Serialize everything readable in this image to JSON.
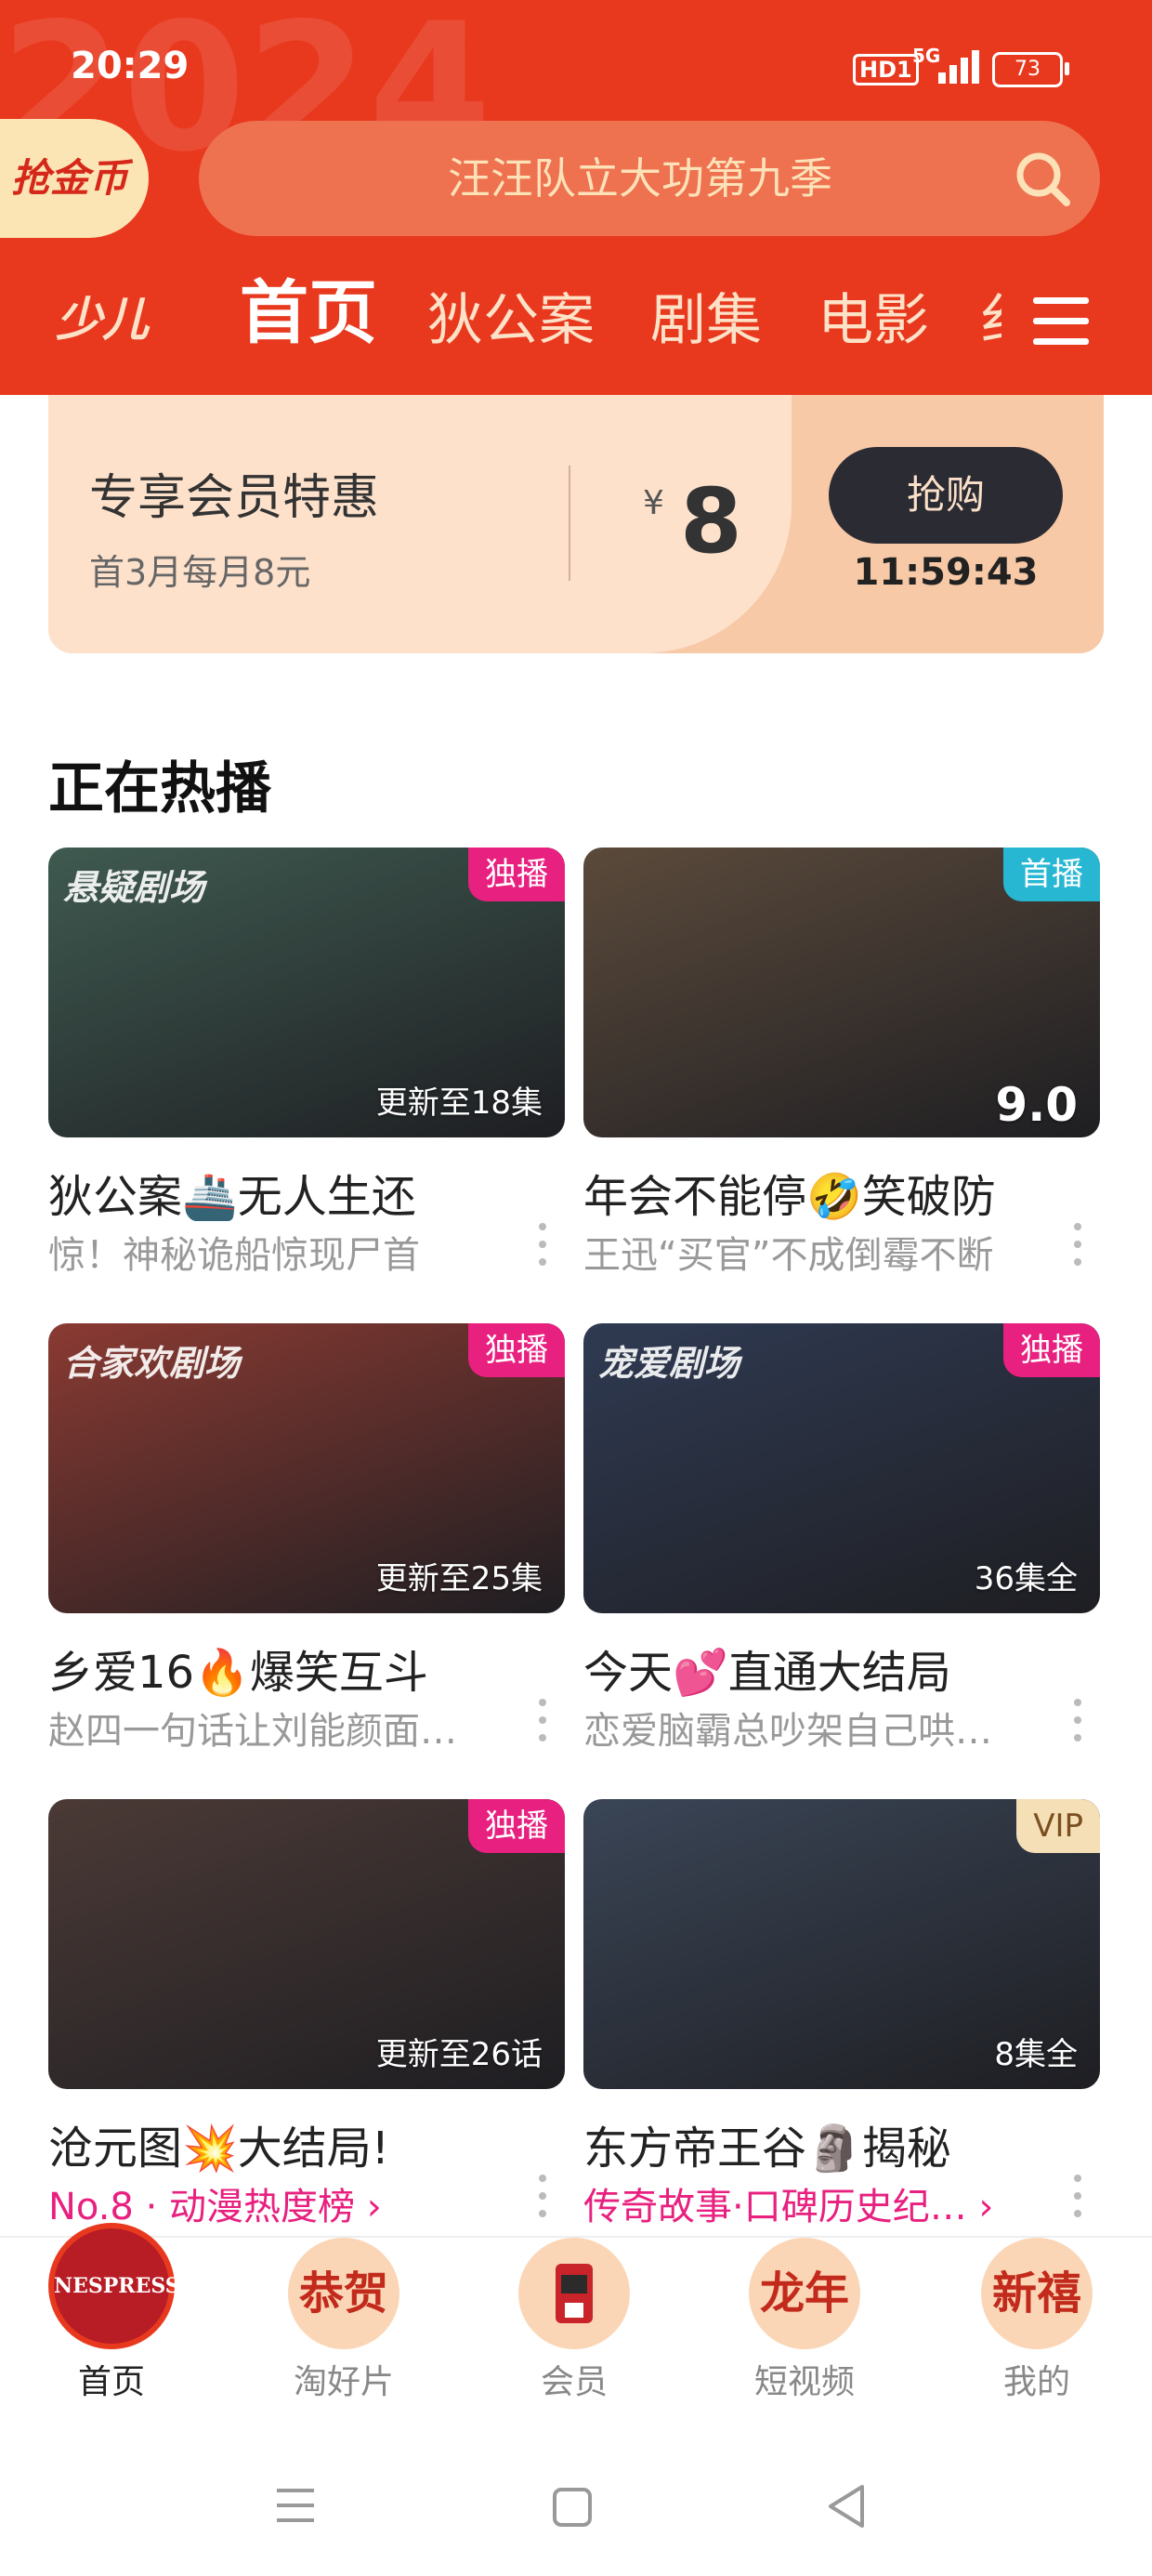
{
  "status_bar": {
    "time": "20:29",
    "hd": "HD1",
    "network": "5G",
    "battery": "73"
  },
  "header": {
    "coin_label": "抢金币",
    "search_placeholder": "汪汪队立大功第九季",
    "watermark": "2024",
    "logo_text": "少儿",
    "tabs": [
      "首页",
      "狄公案",
      "剧集",
      "电影",
      "纟"
    ]
  },
  "promo": {
    "title": "专享会员特惠",
    "subtitle": "首3月每月8元",
    "currency": "¥",
    "price": "8",
    "button": "抢购",
    "countdown": "11:59:43"
  },
  "section_title": "正在热播",
  "cards": [
    {
      "brand": "悬疑剧场",
      "badge": "独播",
      "badge_type": "pink",
      "overlay": "更新至18集",
      "title": "狄公案🚢无人生还",
      "subtitle": "惊！神秘诡船惊现尸首",
      "thumb_color": "#3f5a50"
    },
    {
      "brand": "",
      "badge": "首播",
      "badge_type": "cyan",
      "overlay": "9.0",
      "title": "年会不能停🤣笑破防",
      "subtitle": "王迅“买官”不成倒霉不断",
      "thumb_color": "#5b4a3b"
    },
    {
      "brand": "合家欢剧场",
      "badge": "独播",
      "badge_type": "pink",
      "overlay": "更新至25集",
      "title": "乡爱16🔥爆笑互斗",
      "subtitle": "赵四一句话让刘能颜面…",
      "thumb_color": "#8a3a32"
    },
    {
      "brand": "宠爱剧场",
      "badge": "独播",
      "badge_type": "pink",
      "overlay": "36集全",
      "title": "今天💕直通大结局",
      "subtitle": "恋爱脑霸总吵架自己哄…",
      "thumb_color": "#2f3a52"
    },
    {
      "brand": "",
      "badge": "独播",
      "badge_type": "pink",
      "overlay": "更新至26话",
      "title": "沧元图💥大结局!",
      "subtitle": "No.8 · 动漫热度榜 ›",
      "thumb_color": "#4b3a36"
    },
    {
      "brand": "",
      "badge": "VIP",
      "badge_type": "vip",
      "overlay": "8集全",
      "title": "东方帝王谷🗿揭秘",
      "subtitle": "传奇故事·口碑历史纪… ›",
      "thumb_color": "#3a4556"
    }
  ],
  "tabbar": [
    {
      "label": "首页",
      "icon": "NESPRESSO",
      "active": true
    },
    {
      "label": "淘好片",
      "icon": "恭贺",
      "active": false
    },
    {
      "label": "会员",
      "icon": "coffee-machine",
      "active": false
    },
    {
      "label": "短视频",
      "icon": "龙年",
      "active": false
    },
    {
      "label": "我的",
      "icon": "新禧",
      "active": false
    }
  ]
}
